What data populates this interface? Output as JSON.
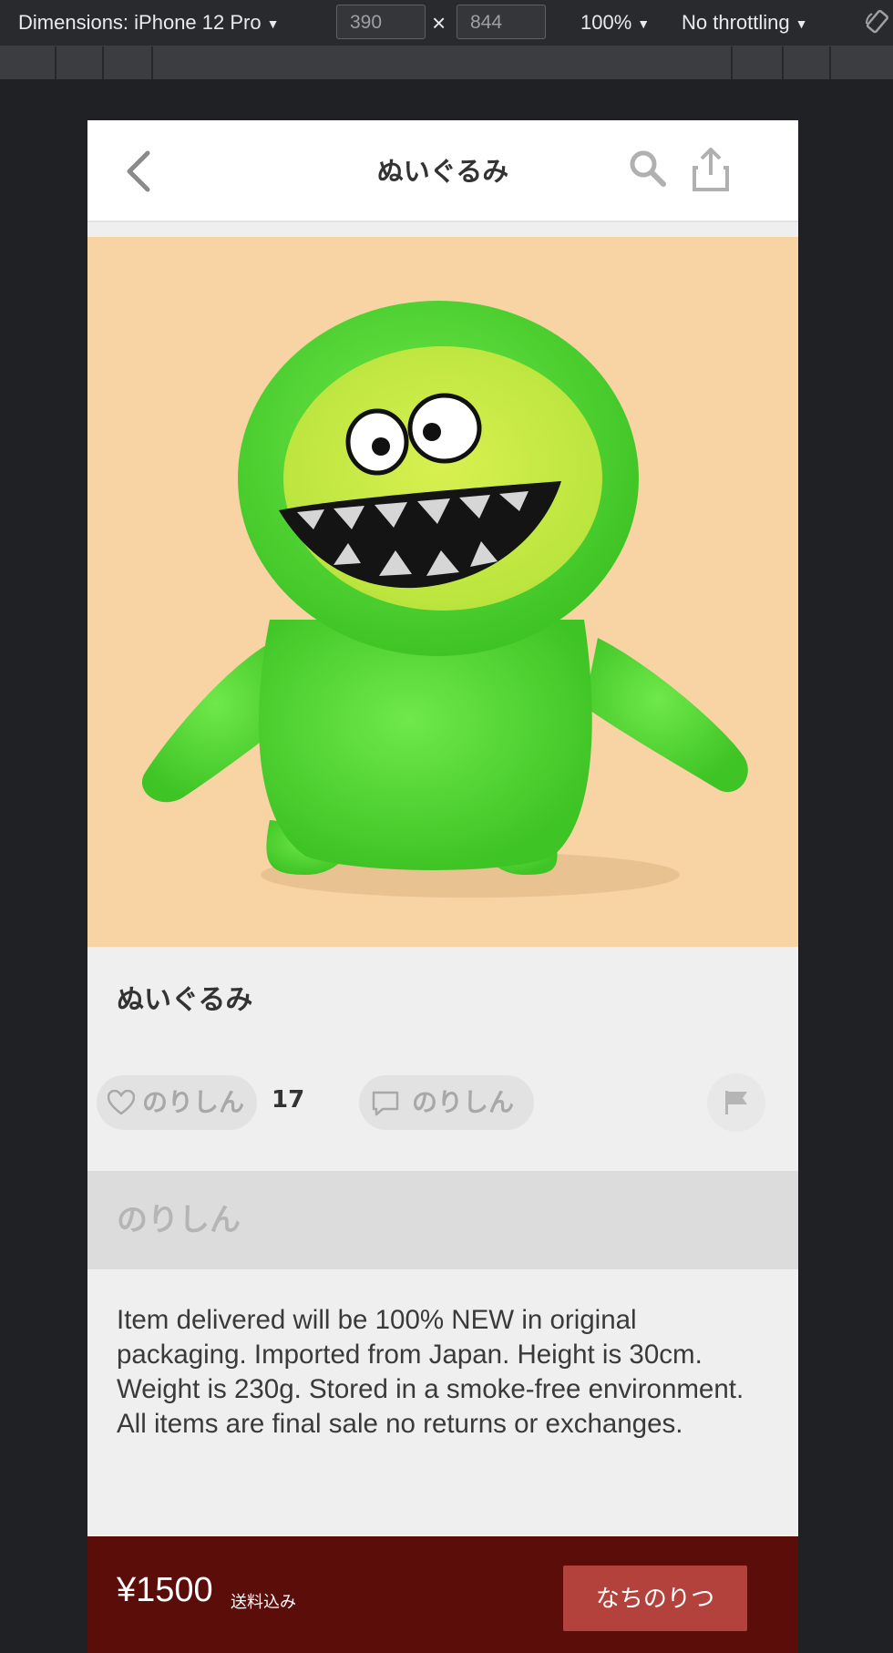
{
  "devtools": {
    "device_label": "Dimensions: iPhone 12 Pro",
    "width_value": "390",
    "height_value": "844",
    "times_sign": "×",
    "zoom": "100%",
    "throttling": "No throttling",
    "caret": "▼"
  },
  "header": {
    "title": "ぬいぐるみ"
  },
  "item": {
    "name": "ぬいぐるみ",
    "like_user": "のりしん",
    "like_count": "17",
    "comment_user": "のりしん",
    "seller": "のりしん",
    "description": "Item delivered will be 100% NEW in original packaging. Imported from Japan. Height is 30cm. Weight is 230g. Stored in a smoke-free environment. All items are final sale no returns or exchanges."
  },
  "footer": {
    "price": "¥1500",
    "shipping": "送料込み",
    "buy_label": "なちのりつ"
  },
  "colors": {
    "photo_bg": "#f8d3a3",
    "plush_green": "#4fd832",
    "footer_bg": "#5b0d0a",
    "buy_button": "#b3423d"
  },
  "icons": [
    "back-icon",
    "search-icon",
    "share-icon",
    "heart-icon",
    "comment-icon",
    "flag-icon",
    "rotate-icon"
  ]
}
